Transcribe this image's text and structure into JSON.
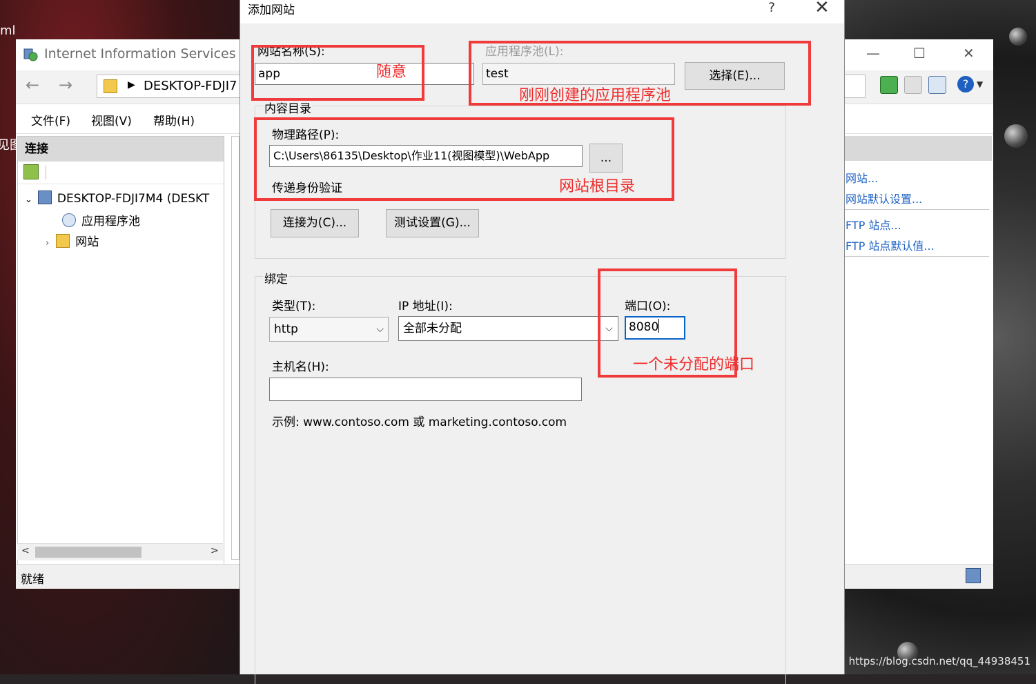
{
  "desktop": {
    "left_fragment_1": "ml",
    "left_fragment_2": "见图",
    "watermark": "https://blog.csdn.net/qq_44938451"
  },
  "iis": {
    "title": "Internet Information Services (IIS)",
    "address": "DESKTOP-FDJI7",
    "minimize": "—",
    "maximize": "☐",
    "close": "✕",
    "menu": [
      "文件(F)",
      "视图(V)",
      "帮助(H)"
    ],
    "connections_header": "连接",
    "tree": {
      "server": "DESKTOP-FDJI7M4 (DESKT",
      "app_pools": "应用程序池",
      "sites": "网站"
    },
    "actions": [
      "网站...",
      "网站默认设置...",
      "FTP 站点...",
      "FTP 站点默认值..."
    ],
    "status": "就绪"
  },
  "dialog": {
    "title": "添加网站",
    "help": "?",
    "close": "✕",
    "site_name_label": "网站名称(S):",
    "site_name_value": "app",
    "app_pool_label": "应用程序池(L):",
    "app_pool_value": "test",
    "select_button": "选择(E)...",
    "content_dir_label": "内容目录",
    "physical_path_label": "物理路径(P):",
    "physical_path_value": "C:\\Users\\86135\\Desktop\\作业11(视图模型)\\WebApp",
    "browse_button": "...",
    "pass_through_label": "传递身份验证",
    "connect_as_button": "连接为(C)...",
    "test_settings_button": "测试设置(G)...",
    "binding_label": "绑定",
    "type_label": "类型(T):",
    "type_value": "http",
    "ip_label": "IP 地址(I):",
    "ip_value": "全部未分配",
    "port_label": "端口(O):",
    "port_value": "8080",
    "hostname_label": "主机名(H):",
    "hostname_value": "",
    "example_text": "示例: www.contoso.com 或 marketing.contoso.com"
  },
  "annotations": {
    "color": "#ef3b3b",
    "site_name_note": "随意",
    "app_pool_note": "刚刚创建的应用程序池",
    "physical_path_note": "网站根目录",
    "port_note": "一个未分配的端口"
  }
}
